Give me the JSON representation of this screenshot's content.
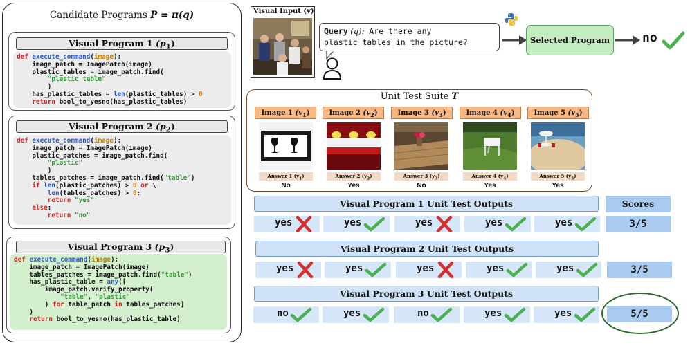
{
  "candidate_panel": {
    "title_prefix": "Candidate Programs ",
    "title_math": "P = π(q)"
  },
  "programs": [
    {
      "label": "Visual Program 1",
      "label_var": "(p",
      "label_sub": "1",
      "label_close": ")"
    },
    {
      "label": "Visual Program 2",
      "label_var": "(p",
      "label_sub": "2",
      "label_close": ")"
    },
    {
      "label": "Visual Program 3",
      "label_var": "(p",
      "label_sub": "3",
      "label_close": ")"
    }
  ],
  "code": {
    "def": "def",
    "fn_name": "execute_command",
    "arg": "image",
    "p1": {
      "l2": "    image_patch = ImagePatch(image)",
      "l3": "    plastic_tables = image_patch.find(",
      "l4": "\"plastic table\"",
      "l5": "        )",
      "l6a": "    has_plastic_tables = ",
      "l6len": "len",
      "l6b": "(plastic_tables) > ",
      "l6num": "0",
      "l7kw": "return",
      "l7b": " bool_to_yesno(has_plastic_tables)"
    },
    "p2": {
      "l2": "    image_patch = ImagePatch(image)",
      "l3": "    plastic_patches = image_patch.find(",
      "l4": "\"plastic\"",
      "l5": "        )",
      "l6a": "    tables_patches = image_patch.find(",
      "l6str": "\"table\"",
      "l6b": ")",
      "l7if": "if",
      "l7len": "len",
      "l7b": "(plastic_patches) > ",
      "l7num": "0",
      "l7or": "or",
      "l7c": " \\",
      "l8len": "len",
      "l8b": "(tables_patches) > ",
      "l8num": "0",
      "l8c": ":",
      "l9kw": "return",
      "l9str": "\"yes\"",
      "l10kw": "else",
      "l10c": ":",
      "l11kw": "return",
      "l11str": "\"no\""
    },
    "p3": {
      "l2": "    image_patch = ImagePatch(image)",
      "l3a": "    tables_patches = image_patch.find(",
      "l3str": "\"table\"",
      "l3b": ")",
      "l4a": "    has_plastic_table = ",
      "l4any": "any",
      "l4b": "([",
      "l5": "        image_patch.verify_property(",
      "l6s1": "\"table\"",
      "l6c": ", ",
      "l6s2": "\"plastic\"",
      "l7a": "        ) ",
      "l7for": "for",
      "l7b": " table_patch ",
      "l7in": "in",
      "l7c": " tables_patches]",
      "l8": "    )",
      "l9kw": "return",
      "l9b": " bool_to_yesno(has_plastic_table)"
    }
  },
  "visual_input": {
    "label": "Visual Input (v)"
  },
  "query": {
    "label": "Query",
    "var": "(q):",
    "text_line1": " Are there any",
    "text_line2": "plastic tables in the picture?"
  },
  "selected_program": {
    "label": "Selected Program"
  },
  "final_answer": {
    "value": "no"
  },
  "unit_test_suite": {
    "title_prefix": "Unit Test Suite ",
    "title_math": "T",
    "images": [
      {
        "label": "Image 1 ",
        "var": "(v",
        "sub": "1",
        "close": ")",
        "answer_label": "Answer 1 (y",
        "answer_sub": "1",
        "answer_close": ")",
        "answer": "No"
      },
      {
        "label": "Image 2 ",
        "var": "(v",
        "sub": "2",
        "close": ")",
        "answer_label": "Answer 2 (y",
        "answer_sub": "2",
        "answer_close": ")",
        "answer": "Yes"
      },
      {
        "label": "Image 3 ",
        "var": "(v",
        "sub": "3",
        "close": ")",
        "answer_label": "Answer 3 (y",
        "answer_sub": "3",
        "answer_close": ")",
        "answer": "No"
      },
      {
        "label": "Image 4 ",
        "var": "(v",
        "sub": "4",
        "close": ")",
        "answer_label": "Answer 4 (y",
        "answer_sub": "4",
        "answer_close": ")",
        "answer": "Yes"
      },
      {
        "label": "Image 5 ",
        "var": "(v",
        "sub": "5",
        "close": ")",
        "answer_label": "Answer 5 (y",
        "answer_sub": "5",
        "answer_close": ")",
        "answer": "Yes"
      }
    ]
  },
  "scores_header": "Scores",
  "outputs": [
    {
      "title": "Visual Program 1 Unit Test Outputs",
      "results": [
        {
          "text": "yes",
          "correct": false
        },
        {
          "text": "yes",
          "correct": true
        },
        {
          "text": "yes",
          "correct": false
        },
        {
          "text": "yes",
          "correct": true
        },
        {
          "text": "yes",
          "correct": true
        }
      ],
      "score": "3/5"
    },
    {
      "title": "Visual Program 2 Unit Test Outputs",
      "results": [
        {
          "text": "yes",
          "correct": false
        },
        {
          "text": "yes",
          "correct": true
        },
        {
          "text": "yes",
          "correct": false
        },
        {
          "text": "yes",
          "correct": true
        },
        {
          "text": "yes",
          "correct": true
        }
      ],
      "score": "3/5"
    },
    {
      "title": "Visual Program 3 Unit Test Outputs",
      "results": [
        {
          "text": "no",
          "correct": true
        },
        {
          "text": "yes",
          "correct": true
        },
        {
          "text": "no",
          "correct": true
        },
        {
          "text": "yes",
          "correct": true
        },
        {
          "text": "yes",
          "correct": true
        }
      ],
      "score": "5/5"
    }
  ],
  "colors": {
    "correct": "#4caf50",
    "wrong": "#d32f2f",
    "selected": "#c4ecc0",
    "highlight": "#2d6a2d"
  }
}
